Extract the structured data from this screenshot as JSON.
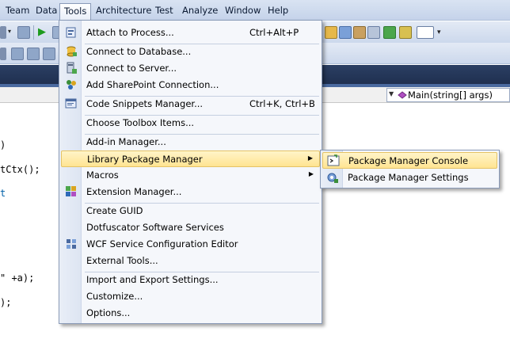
{
  "menubar": {
    "items": [
      {
        "label": "Team"
      },
      {
        "label": "Data"
      },
      {
        "label": "Tools"
      },
      {
        "label": "Architecture"
      },
      {
        "label": "Test"
      },
      {
        "label": "Analyze"
      },
      {
        "label": "Window"
      },
      {
        "label": "Help"
      }
    ],
    "active": "Tools"
  },
  "navbar": {
    "member_selected": "Main(string[] args)"
  },
  "code": {
    "lines": [
      ")",
      "tCtx();",
      "t",
      "\" +a);",
      ");"
    ]
  },
  "tools_menu": {
    "items": [
      {
        "label": "Attach to Process...",
        "shortcut": "Ctrl+Alt+P",
        "icon": "attach-process-icon"
      },
      {
        "label": "Connect to Database...",
        "shortcut": "",
        "icon": "connect-database-icon"
      },
      {
        "label": "Connect to Server...",
        "shortcut": "",
        "icon": "connect-server-icon"
      },
      {
        "label": "Add SharePoint Connection...",
        "shortcut": "",
        "icon": "sharepoint-icon"
      },
      {
        "label": "Code Snippets Manager...",
        "shortcut": "Ctrl+K, Ctrl+B",
        "icon": "code-snippets-icon"
      },
      {
        "label": "Choose Toolbox Items...",
        "shortcut": "",
        "icon": ""
      },
      {
        "label": "Add-in Manager...",
        "shortcut": "",
        "icon": ""
      },
      {
        "label": "Library Package Manager",
        "shortcut": "",
        "icon": "",
        "submenu": true
      },
      {
        "label": "Macros",
        "shortcut": "",
        "icon": "",
        "submenu": true
      },
      {
        "label": "Extension Manager...",
        "shortcut": "",
        "icon": "extension-manager-icon"
      },
      {
        "label": "Create GUID",
        "shortcut": "",
        "icon": ""
      },
      {
        "label": "Dotfuscator Software Services",
        "shortcut": "",
        "icon": ""
      },
      {
        "label": "WCF Service Configuration Editor",
        "shortcut": "",
        "icon": "wcf-config-icon"
      },
      {
        "label": "External Tools...",
        "shortcut": "",
        "icon": ""
      },
      {
        "label": "Import and Export Settings...",
        "shortcut": "",
        "icon": ""
      },
      {
        "label": "Customize...",
        "shortcut": "",
        "icon": ""
      },
      {
        "label": "Options...",
        "shortcut": "",
        "icon": ""
      }
    ],
    "highlighted": "Library Package Manager"
  },
  "library_package_submenu": {
    "items": [
      {
        "label": "Package Manager Console",
        "icon": "package-console-icon"
      },
      {
        "label": "Package Manager Settings",
        "icon": "package-settings-icon"
      }
    ],
    "highlighted": "Package Manager Console"
  },
  "colors": {
    "highlight": "#ffe492",
    "tabstrip": "#2b3f63",
    "keyword": "#0060a8"
  }
}
